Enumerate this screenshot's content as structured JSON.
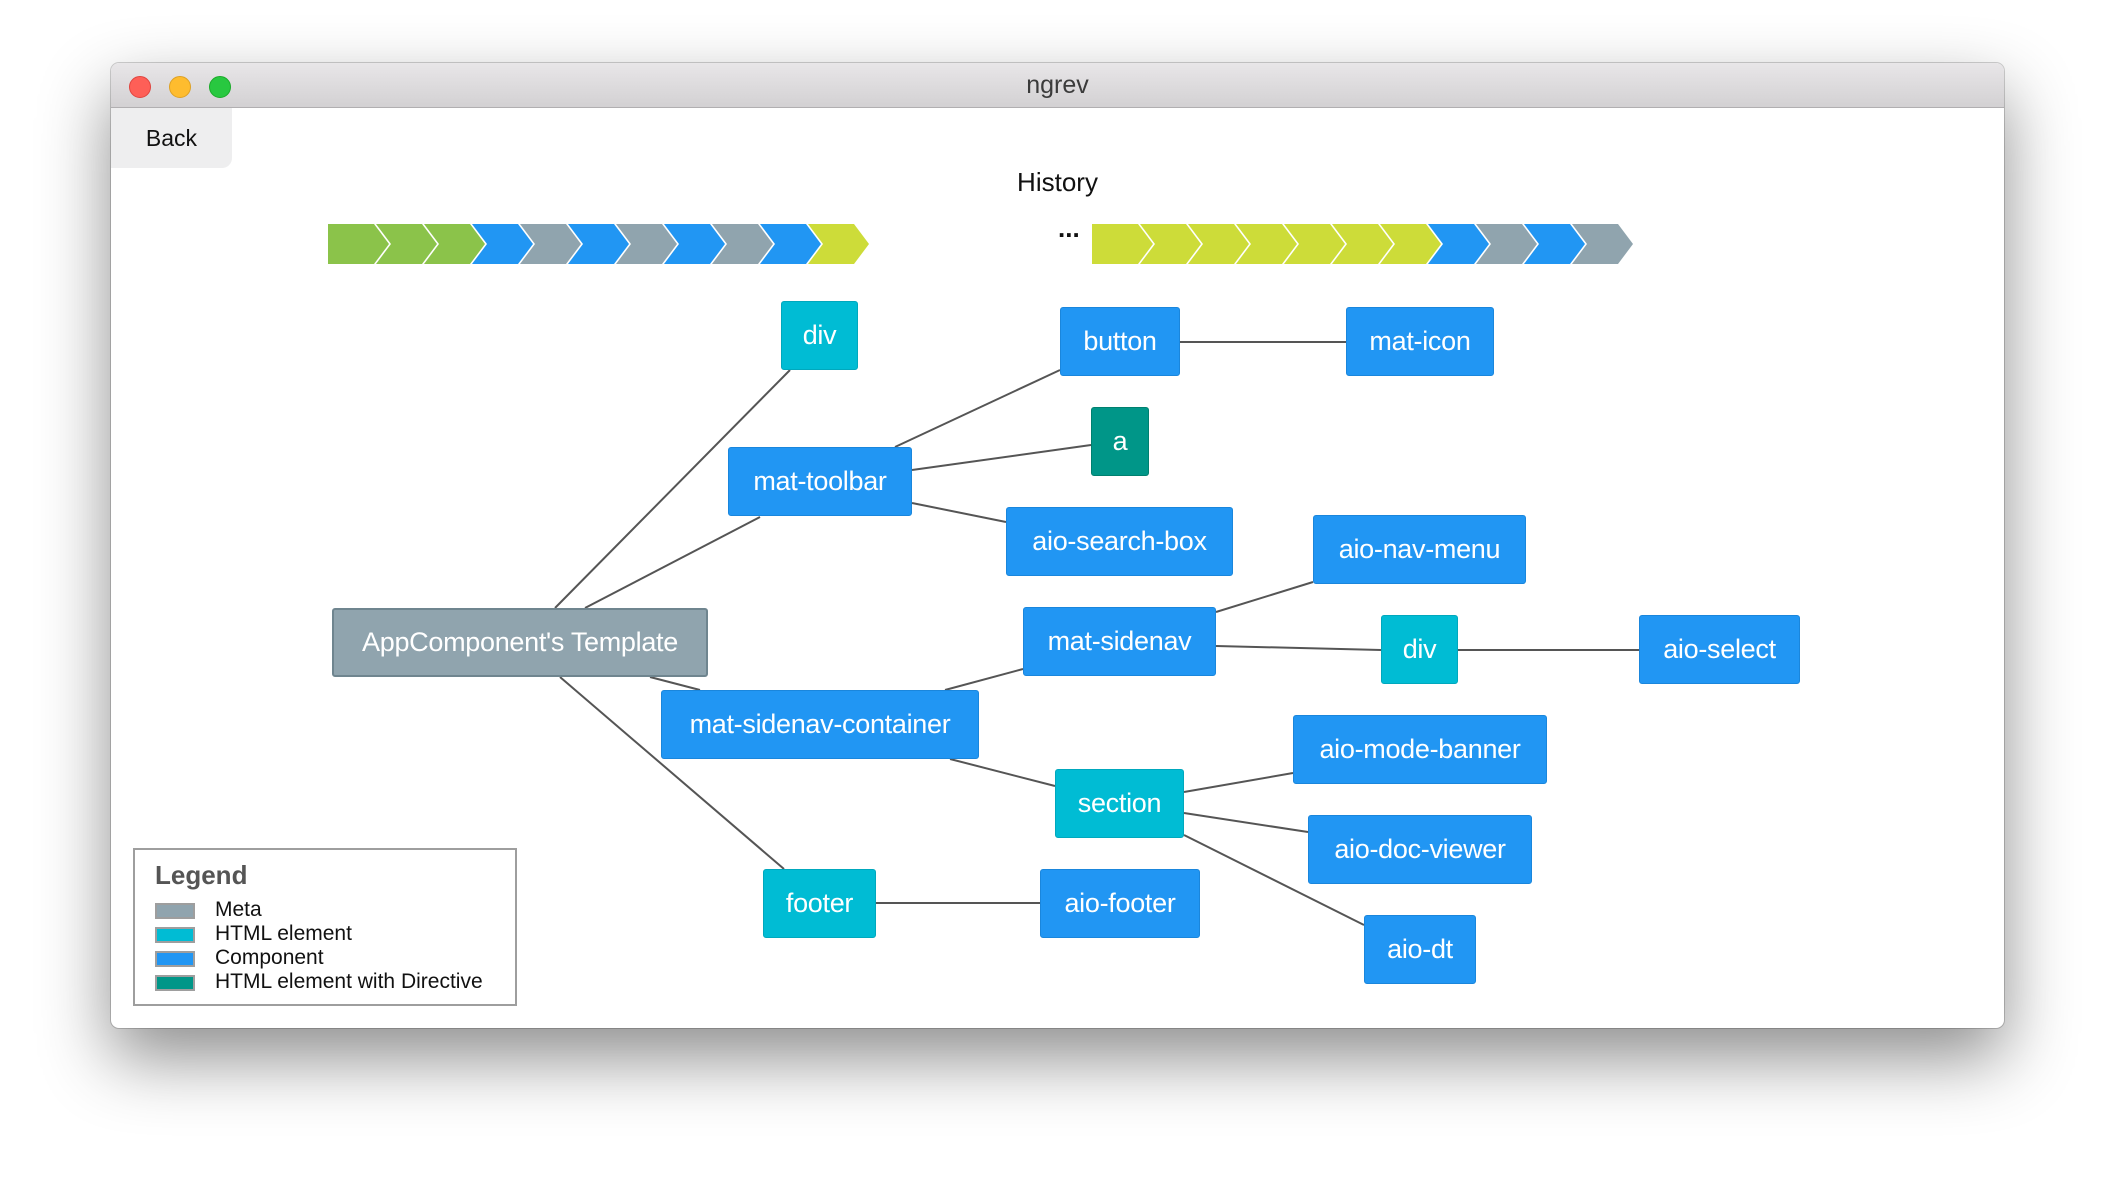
{
  "window": {
    "title": "ngrev"
  },
  "toolbar": {
    "back_label": "Back"
  },
  "history": {
    "title": "History",
    "ellipsis": "...",
    "left_steps": [
      "Directive",
      "Directive",
      "Directive",
      "Component",
      "Meta",
      "Component",
      "Meta",
      "Component",
      "Meta",
      "Component",
      "Module"
    ],
    "right_steps": [
      "Module",
      "Module",
      "Module",
      "Module",
      "Module",
      "Module",
      "Module",
      "Component",
      "Meta",
      "Component",
      "Meta"
    ]
  },
  "colors": {
    "meta": "#90a4ae",
    "html_element": "#00bcd4",
    "component": "#2196f3",
    "html_element_with_directive": "#009688",
    "history_green": "#8bc34a",
    "history_lime": "#cddc39",
    "edge": "#555555"
  },
  "graph": {
    "nodes": {
      "root": "AppComponent's Template",
      "div_top": "div",
      "mat_toolbar": "mat-toolbar",
      "button": "button",
      "mat_icon": "mat-icon",
      "a": "a",
      "aio_search_box": "aio-search-box",
      "mat_sidenav_container": "mat-sidenav-container",
      "mat_sidenav": "mat-sidenav",
      "aio_nav_menu": "aio-nav-menu",
      "div_sidenav": "div",
      "aio_select": "aio-select",
      "section": "section",
      "aio_mode_banner": "aio-mode-banner",
      "aio_doc_viewer": "aio-doc-viewer",
      "aio_dt": "aio-dt",
      "footer": "footer",
      "aio_footer": "aio-footer"
    },
    "edges": [
      [
        "root",
        "div_top"
      ],
      [
        "root",
        "mat_toolbar"
      ],
      [
        "root",
        "mat_sidenav_container"
      ],
      [
        "root",
        "footer"
      ],
      [
        "mat_toolbar",
        "button"
      ],
      [
        "mat_toolbar",
        "a"
      ],
      [
        "mat_toolbar",
        "aio_search_box"
      ],
      [
        "button",
        "mat_icon"
      ],
      [
        "mat_sidenav_container",
        "mat_sidenav"
      ],
      [
        "mat_sidenav_container",
        "section"
      ],
      [
        "mat_sidenav",
        "aio_nav_menu"
      ],
      [
        "mat_sidenav",
        "div_sidenav"
      ],
      [
        "div_sidenav",
        "aio_select"
      ],
      [
        "section",
        "aio_mode_banner"
      ],
      [
        "section",
        "aio_doc_viewer"
      ],
      [
        "section",
        "aio_dt"
      ],
      [
        "footer",
        "aio_footer"
      ]
    ]
  },
  "legend": {
    "title": "Legend",
    "items": [
      {
        "label": "Meta",
        "color": "#90a4ae"
      },
      {
        "label": "HTML element",
        "color": "#00bcd4"
      },
      {
        "label": "Component",
        "color": "#2196f3"
      },
      {
        "label": "HTML element with Directive",
        "color": "#009688"
      }
    ]
  }
}
